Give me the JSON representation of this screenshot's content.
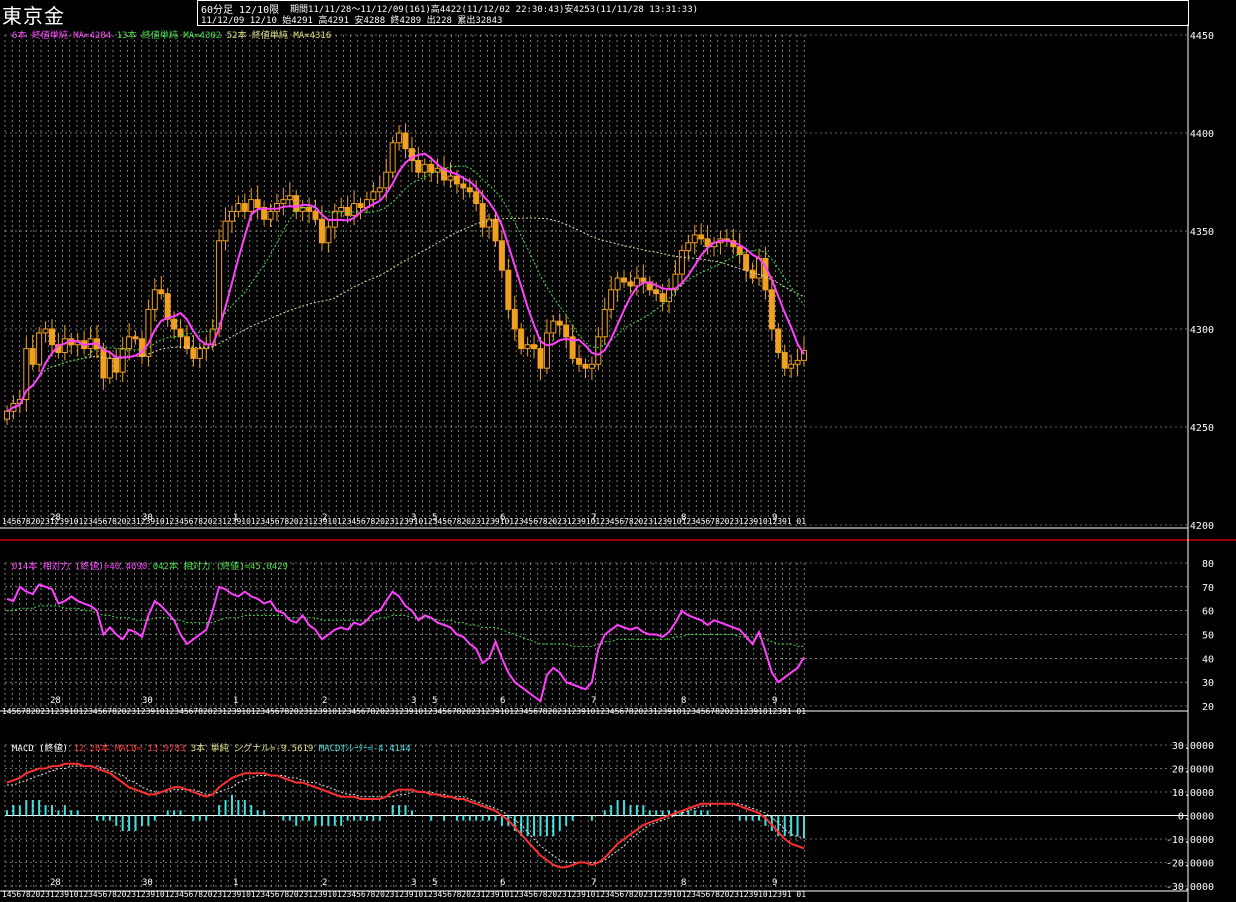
{
  "header": {
    "title": "東京金",
    "timeframe": "60分足 12/10限",
    "period_info": "期間11/11/28～11/12/09(161)高4422(11/12/02 22:30:43)安4253(11/11/28 13:31:33)",
    "day_info": "11/12/09 12/10 始4291 高4291 安4288 終4289 出228 累出32843"
  },
  "colors": {
    "candle": "#f0a020",
    "ma_short": "#ff40ff",
    "ma_mid": "#40e040",
    "ma_long": "#e0e0a0",
    "rsi_short": "#ff40ff",
    "rsi_long": "#40e040",
    "macd": "#ff3030",
    "signal": "#e0e0e0",
    "osc": "#40e0e0",
    "grid": "#d0d0d0",
    "frame": "#ff0000"
  },
  "legends": {
    "price": [
      {
        "text": "6本 終値単純 MA=4284",
        "color": "#ff40ff"
      },
      {
        "text": "13本 終値単純 MA=4302",
        "color": "#40e040"
      },
      {
        "text": "52本 終値単純 MA=4316",
        "color": "#e0e080"
      }
    ],
    "rsi": [
      {
        "text": "014本 相対力 (終値)=40.4690",
        "color": "#ff40ff"
      },
      {
        "text": "042本 相対力 (終値)=45.0429",
        "color": "#40e040"
      }
    ],
    "macd": [
      {
        "text": "MACD (終値)",
        "color": "#ffffff"
      },
      {
        "text": "12-26本 MACD=-13.9783",
        "color": "#ff3030"
      },
      {
        "text": "3本 単純 シグナル=-9.5619",
        "color": "#e0e080"
      },
      {
        "text": "MACDｵｼﾚｰﾀｰ=-4.4144",
        "color": "#40e0e0"
      }
    ]
  },
  "axis_labels": {
    "price_ticks": [
      "4450",
      "4400",
      "4350",
      "4300",
      "4250",
      "4200"
    ],
    "rsi_ticks": [
      "80",
      "70",
      "60",
      "50",
      "40",
      "30",
      "20"
    ],
    "macd_ticks": [
      "30.0000",
      "20.0000",
      "10.0000",
      "0.0000",
      "-10.0000",
      "-20.0000",
      "-30.0000"
    ],
    "day_labels": [
      "28",
      "30",
      "1",
      "2",
      "3",
      "5",
      "6",
      "7",
      "8",
      "9"
    ],
    "hour_strip": "145678202312391012345678202312391012345678202312391012345678202312391012345678202312391012345678202312391012345678202312391012345678202312391012345678202312391012391 01"
  },
  "chart_data": [
    {
      "type": "candlestick",
      "title": "東京金 60分足 12/10限",
      "ylim": [
        4200,
        4450
      ],
      "y_ticks": [
        4200,
        4250,
        4300,
        4350,
        4400,
        4450
      ],
      "x_day_labels": [
        "28",
        "30",
        "1",
        "2",
        "3",
        "5",
        "6",
        "7",
        "8",
        "9"
      ],
      "series": [
        {
          "name": "6本 終値単純 MA=4284",
          "last": 4284
        },
        {
          "name": "13本 終値単純 MA=4302",
          "last": 4302
        },
        {
          "name": "52本 終値単純 MA=4316",
          "last": 4316
        }
      ],
      "close": [
        4258,
        4262,
        4264,
        4290,
        4282,
        4298,
        4300,
        4292,
        4288,
        4295,
        4292,
        4294,
        4290,
        4295,
        4290,
        4275,
        4285,
        4278,
        4290,
        4296,
        4295,
        4286,
        4310,
        4320,
        4318,
        4305,
        4300,
        4296,
        4290,
        4285,
        4290,
        4292,
        4300,
        4345,
        4355,
        4360,
        4364,
        4360,
        4366,
        4362,
        4356,
        4360,
        4364,
        4366,
        4368,
        4360,
        4362,
        4360,
        4356,
        4344,
        4352,
        4360,
        4362,
        4358,
        4364,
        4362,
        4366,
        4370,
        4372,
        4380,
        4395,
        4400,
        4392,
        4386,
        4380,
        4384,
        4380,
        4382,
        4376,
        4378,
        4374,
        4372,
        4370,
        4364,
        4352,
        4356,
        4345,
        4330,
        4310,
        4300,
        4290,
        4292,
        4290,
        4280,
        4298,
        4304,
        4302,
        4296,
        4285,
        4282,
        4280,
        4282,
        4296,
        4310,
        4320,
        4326,
        4324,
        4322,
        4326,
        4324,
        4320,
        4318,
        4314,
        4320,
        4328,
        4340,
        4344,
        4348,
        4346,
        4342,
        4344,
        4346,
        4345,
        4342,
        4338,
        4330,
        4326,
        4336,
        4320,
        4300,
        4288,
        4280,
        4282,
        4284,
        4289
      ],
      "high": 4422,
      "low": 4253
    },
    {
      "type": "line",
      "title": "相対力",
      "ylim": [
        20,
        80
      ],
      "y_ticks": [
        20,
        30,
        40,
        50,
        60,
        70,
        80
      ],
      "series": [
        {
          "name": "014本 相対力 (終値)=40.4690",
          "last": 40.469,
          "values": [
            65,
            64,
            70,
            68,
            67,
            71,
            70,
            69,
            63,
            64,
            66,
            64,
            63,
            62,
            60,
            50,
            53,
            50,
            48,
            52,
            51,
            49,
            58,
            64,
            62,
            59,
            56,
            50,
            46,
            48,
            50,
            52,
            60,
            70,
            69,
            67,
            66,
            68,
            66,
            65,
            63,
            64,
            60,
            59,
            56,
            55,
            58,
            54,
            52,
            48,
            50,
            52,
            53,
            52,
            55,
            54,
            56,
            59,
            60,
            64,
            68,
            66,
            62,
            60,
            56,
            58,
            57,
            55,
            54,
            53,
            50,
            49,
            46,
            44,
            38,
            40,
            47,
            40,
            34,
            30,
            28,
            26,
            24,
            22,
            33,
            36,
            34,
            30,
            29,
            28,
            27,
            30,
            44,
            50,
            52,
            54,
            53,
            52,
            53,
            51,
            50,
            50,
            49,
            51,
            55,
            60,
            58,
            57,
            56,
            54,
            56,
            55,
            54,
            53,
            52,
            49,
            46,
            51,
            43,
            34,
            30,
            32,
            34,
            36,
            40.469
          ]
        },
        {
          "name": "042本 相対力 (終値)=45.0429",
          "last": 45.0429,
          "values": [
            60,
            60,
            61,
            61,
            61,
            62,
            62,
            62,
            62,
            61,
            61,
            61,
            60,
            60,
            59,
            58,
            58,
            57,
            57,
            57,
            56,
            56,
            56,
            57,
            57,
            57,
            56,
            56,
            55,
            55,
            55,
            55,
            55,
            56,
            57,
            57,
            57,
            58,
            58,
            58,
            58,
            58,
            58,
            58,
            57,
            57,
            57,
            57,
            57,
            56,
            56,
            56,
            56,
            56,
            56,
            56,
            56,
            56,
            57,
            57,
            58,
            58,
            58,
            57,
            57,
            57,
            57,
            56,
            56,
            56,
            55,
            55,
            54,
            54,
            53,
            53,
            53,
            52,
            51,
            50,
            49,
            48,
            47,
            46,
            46,
            46,
            46,
            46,
            45,
            45,
            45,
            45,
            46,
            47,
            47,
            48,
            48,
            48,
            48,
            48,
            48,
            48,
            48,
            48,
            49,
            49,
            50,
            50,
            50,
            50,
            50,
            50,
            50,
            50,
            49,
            49,
            49,
            49,
            48,
            47,
            46,
            46,
            46,
            45,
            45.0429
          ]
        }
      ]
    },
    {
      "type": "line",
      "title": "MACD (終値)",
      "ylim": [
        -30,
        30
      ],
      "y_ticks": [
        30,
        20,
        10,
        0,
        -10,
        -20,
        -30
      ],
      "series": [
        {
          "name": "12-26本 MACD=-13.9783",
          "last": -13.9783,
          "values": [
            14,
            15,
            16,
            18,
            19,
            20,
            20,
            21,
            21,
            22,
            22,
            22,
            21,
            21,
            20,
            19,
            18,
            16,
            14,
            12,
            11,
            10,
            9,
            9,
            10,
            11,
            12,
            12,
            11,
            10,
            9,
            8,
            9,
            12,
            14,
            16,
            17,
            18,
            18,
            18,
            18,
            17,
            17,
            16,
            15,
            14,
            14,
            13,
            12,
            11,
            10,
            9,
            8,
            8,
            8,
            7,
            7,
            7,
            7,
            8,
            10,
            11,
            11,
            11,
            10,
            10,
            9,
            9,
            8,
            8,
            7,
            7,
            6,
            5,
            4,
            3,
            2,
            0,
            -2,
            -5,
            -8,
            -11,
            -14,
            -17,
            -19,
            -21,
            -22,
            -22,
            -21,
            -20,
            -20,
            -21,
            -20,
            -18,
            -15,
            -12,
            -10,
            -8,
            -6,
            -4,
            -3,
            -2,
            -1,
            0,
            1,
            2,
            3,
            4,
            5,
            5,
            5,
            5,
            5,
            5,
            4,
            3,
            2,
            1,
            -1,
            -4,
            -7,
            -10,
            -12,
            -13,
            -13.98
          ]
        },
        {
          "name": "3本 単純 シグナル=-9.5619",
          "last": -9.5619,
          "values": [
            13,
            13,
            14,
            15,
            16,
            17,
            18,
            19,
            20,
            20,
            21,
            21,
            21,
            21,
            21,
            20,
            19,
            18,
            17,
            15,
            14,
            12,
            11,
            10,
            10,
            10,
            11,
            11,
            11,
            11,
            10,
            9,
            9,
            10,
            11,
            12,
            14,
            15,
            16,
            17,
            17,
            17,
            17,
            17,
            16,
            16,
            15,
            14,
            14,
            13,
            12,
            11,
            10,
            9,
            9,
            8,
            8,
            8,
            8,
            8,
            8,
            9,
            9,
            10,
            10,
            10,
            10,
            9,
            9,
            8,
            8,
            8,
            7,
            6,
            5,
            4,
            3,
            2,
            0,
            -2,
            -4,
            -7,
            -10,
            -13,
            -15,
            -17,
            -19,
            -20,
            -20,
            -20,
            -20,
            -20,
            -20,
            -19,
            -17,
            -15,
            -13,
            -10,
            -8,
            -6,
            -4,
            -3,
            -2,
            -1,
            0,
            1,
            2,
            3,
            4,
            4,
            5,
            5,
            5,
            5,
            5,
            4,
            3,
            2,
            1,
            -1,
            -3,
            -6,
            -8,
            -9,
            -9.56
          ]
        },
        {
          "name": "MACDｵｼﾚｰﾀｰ=-4.4144",
          "last": -4.4144,
          "values": [
            1,
            2,
            2,
            3,
            3,
            3,
            2,
            2,
            1,
            2,
            1,
            1,
            0,
            0,
            -1,
            -1,
            -1,
            -2,
            -3,
            -3,
            -3,
            -2,
            -2,
            -1,
            0,
            1,
            1,
            1,
            0,
            -1,
            -1,
            -1,
            0,
            2,
            3,
            4,
            3,
            3,
            2,
            1,
            1,
            0,
            0,
            -1,
            -1,
            -2,
            -1,
            -1,
            -2,
            -2,
            -2,
            -2,
            -2,
            -1,
            -1,
            -1,
            -1,
            -1,
            -1,
            0,
            2,
            2,
            2,
            1,
            0,
            0,
            -1,
            0,
            -1,
            0,
            -1,
            -1,
            -1,
            -1,
            -1,
            -1,
            -1,
            -2,
            -2,
            -3,
            -4,
            -4,
            -4,
            -4,
            -4,
            -4,
            -3,
            -2,
            -1,
            0,
            0,
            -1,
            0,
            1,
            2,
            3,
            3,
            2,
            2,
            2,
            1,
            1,
            1,
            1,
            1,
            1,
            1,
            1,
            1,
            1,
            0,
            0,
            0,
            0,
            -1,
            -1,
            -1,
            -1,
            -2,
            -3,
            -4,
            -4,
            -4,
            -4,
            -4.41
          ]
        }
      ]
    }
  ]
}
